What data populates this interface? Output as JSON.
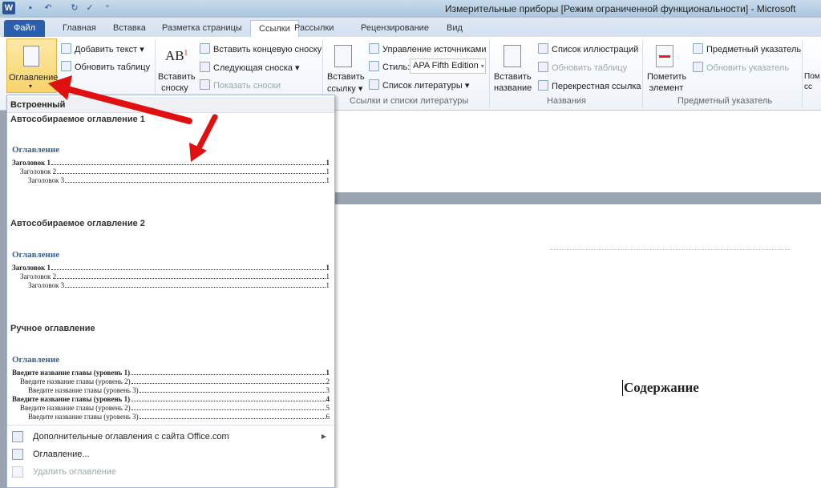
{
  "titlebar": {
    "title": "Измерительные приборы [Режим ограниченной функциональности] - Microsoft"
  },
  "tabs": [
    {
      "label": "Файл"
    },
    {
      "label": "Главная"
    },
    {
      "label": "Вставка"
    },
    {
      "label": "Разметка страницы"
    },
    {
      "label": "Ссылки"
    },
    {
      "label": "Рассылки"
    },
    {
      "label": "Рецензирование"
    },
    {
      "label": "Вид"
    }
  ],
  "ribbon": {
    "toc": {
      "label": "Оглавление",
      "add_text": "Добавить текст",
      "update_table": "Обновить таблицу"
    },
    "footnotes": {
      "insert_line1": "Вставить",
      "insert_line2": "сноску",
      "insert_endnote": "Вставить концевую сноску",
      "next_footnote": "Следующая сноска",
      "show_notes": "Показать сноски",
      "icon_text": "AB"
    },
    "citations": {
      "insert_line1": "Вставить",
      "insert_line2": "ссылку",
      "manage_sources": "Управление источниками",
      "style_label": "Стиль:",
      "style_value": "APA Fifth Edition",
      "bibliography": "Список литературы",
      "group": "Ссылки и списки литературы"
    },
    "captions": {
      "insert_line1": "Вставить",
      "insert_line2": "название",
      "table_of_figures": "Список иллюстраций",
      "update_table": "Обновить таблицу",
      "cross_reference": "Перекрестная ссылка",
      "group": "Названия"
    },
    "index": {
      "mark_line1": "Пометить",
      "mark_line2": "элемент",
      "insert_index": "Предметный указатель",
      "update_index": "Обновить указатель",
      "group": "Предметный указатель"
    },
    "cut": {
      "line1": "Пом",
      "line2": "сс"
    }
  },
  "dropdown": {
    "section": "Встроенный",
    "items": [
      {
        "name": "Автособираемое оглавление 1",
        "heading": "Оглавление",
        "lines": [
          {
            "text": "Заголовок 1",
            "page": "1",
            "level": 1
          },
          {
            "text": "Заголовок 2",
            "page": "1",
            "level": 2
          },
          {
            "text": "Заголовок 3",
            "page": "1",
            "level": 3
          }
        ]
      },
      {
        "name": "Автособираемое оглавление 2",
        "heading": "Оглавление",
        "lines": [
          {
            "text": "Заголовок 1",
            "page": "1",
            "level": 1
          },
          {
            "text": "Заголовок 2",
            "page": "1",
            "level": 2
          },
          {
            "text": "Заголовок 3",
            "page": "1",
            "level": 3
          }
        ]
      },
      {
        "name": "Ручное оглавление",
        "heading": "Оглавление",
        "lines": [
          {
            "text": "Введите название главы (уровень 1)",
            "page": "1",
            "level": 1
          },
          {
            "text": "Введите название главы (уровень 2)",
            "page": "2",
            "level": 2
          },
          {
            "text": "Введите название главы (уровень 3)",
            "page": "3",
            "level": 3
          },
          {
            "text": "Введите название главы (уровень 1)",
            "page": "4",
            "level": 1
          },
          {
            "text": "Введите название главы (уровень 2)",
            "page": "5",
            "level": 2
          },
          {
            "text": "Введите название главы (уровень 3)",
            "page": "6",
            "level": 3
          }
        ]
      }
    ],
    "menu": [
      {
        "label": "Дополнительные оглавления с сайта Office.com",
        "disabled": false,
        "submenu": true
      },
      {
        "label": "Оглавление...",
        "disabled": false
      },
      {
        "label": "Удалить оглавление",
        "disabled": true
      }
    ]
  },
  "document": {
    "heading": "Содержание"
  },
  "colors": {
    "file_tab": "#2a5fb0",
    "toc_heading": "#366092",
    "arrow": "#e01010",
    "highlight": "#f9d36b"
  }
}
